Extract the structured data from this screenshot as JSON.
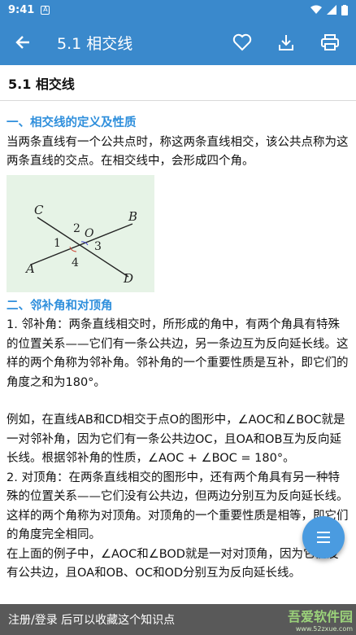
{
  "status_bar": {
    "time": "9:41",
    "notification_icon": "A"
  },
  "app_bar": {
    "title": "5.1 相交线"
  },
  "header": {
    "title": "5.1 相交线"
  },
  "content": {
    "section1_heading": "一、相交线的定义及性质",
    "section1_text": "当两条直线有一个公共点时，称这两条直线相交，该公共点称为这两条直线的交点。在相交线中，会形成四个角。",
    "figure": {
      "labels": [
        "C",
        "B",
        "A",
        "D",
        "O",
        "1",
        "2",
        "3",
        "4"
      ]
    },
    "section2_heading": "二、邻补角和对顶角",
    "para1": "1. 邻补角：两条直线相交时，所形成的角中，有两个角具有特殊的位置关系——它们有一条公共边，另一条边互为反向延长线。这样的两个角称为邻补角。邻补角的一个重要性质是互补，即它们的角度之和为180°。",
    "para2": "例如，在直线AB和CD相交于点O的图形中，∠AOC和∠BOC就是一对邻补角，因为它们有一条公共边OC，且OA和OB互为反向延长线。根据邻补角的性质，∠AOC + ∠BOC = 180°。",
    "para3": "2. 对顶角：在两条直线相交的图形中，还有两个角具有另一种特殊的位置关系——它们没有公共边，但两边分别互为反向延长线。这样的两个角称为对顶角。对顶角的一个重要性质是相等，即它们的角度完全相同。",
    "para4": "在上面的例子中，∠AOC和∠BOD就是一对对顶角，因为它们没有公共边，且OA和OB、OC和OD分别互为反向延长线。"
  },
  "bottom_bar": {
    "text": "注册/登录 后可以收藏这个知识点"
  },
  "watermark": {
    "name": "吾爱软件园",
    "url": "www.52zxue.com"
  },
  "colors": {
    "primary": "#3a89cc",
    "heading": "#2f8fdc",
    "fab": "#4a9be0"
  }
}
